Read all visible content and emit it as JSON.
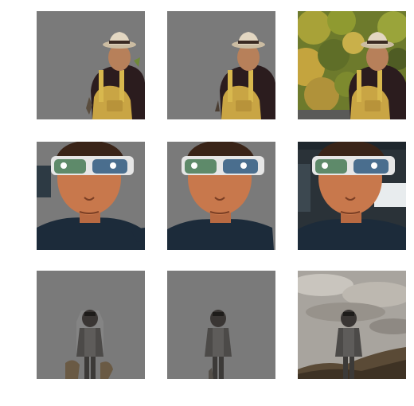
{
  "grid": {
    "rows": 3,
    "columns": 3,
    "cells": [
      {
        "subject": "backpacker-hat",
        "variant": "mask-coarse",
        "background": "gray"
      },
      {
        "subject": "backpacker-hat",
        "variant": "mask-refined",
        "background": "gray"
      },
      {
        "subject": "backpacker-hat",
        "variant": "original",
        "background": "foliage"
      },
      {
        "subject": "man-sunglasses",
        "variant": "mask-coarse",
        "background": "gray"
      },
      {
        "subject": "man-sunglasses",
        "variant": "mask-refined",
        "background": "gray"
      },
      {
        "subject": "man-sunglasses",
        "variant": "original",
        "background": "car-interior"
      },
      {
        "subject": "walking-figure",
        "variant": "mask-coarse",
        "background": "gray"
      },
      {
        "subject": "walking-figure",
        "variant": "mask-refined",
        "background": "gray"
      },
      {
        "subject": "walking-figure",
        "variant": "original",
        "background": "cloudy-sky"
      }
    ]
  },
  "colors": {
    "page_background": "#ffffff",
    "mask_gray": "#7a7a7a"
  }
}
